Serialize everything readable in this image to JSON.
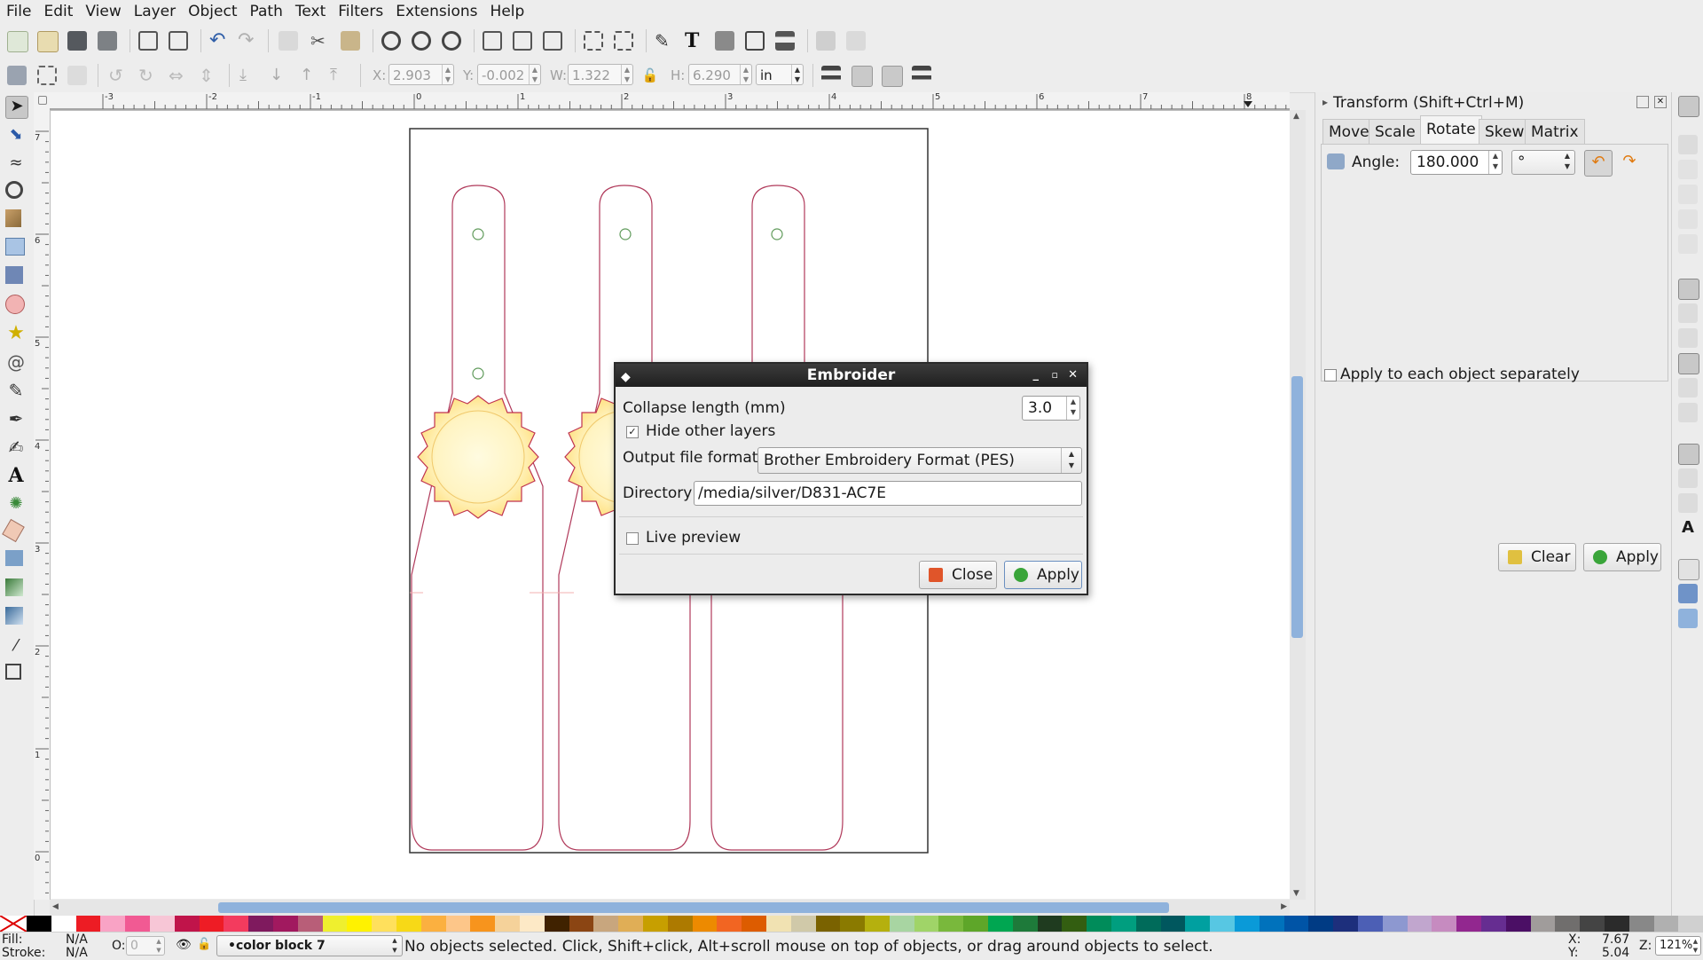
{
  "menu": [
    "File",
    "Edit",
    "View",
    "Layer",
    "Object",
    "Path",
    "Text",
    "Filters",
    "Extensions",
    "Help"
  ],
  "toolbar2": {
    "x_label": "X:",
    "x_value": "2.903",
    "y_label": "Y:",
    "y_value": "-0.002",
    "w_label": "W:",
    "w_value": "1.322",
    "h_label": "H:",
    "h_value": "6.290",
    "unit": "in"
  },
  "ruler_h": [
    "-3",
    "-2",
    "-1",
    "0",
    "1",
    "2",
    "3",
    "4",
    "5",
    "6",
    "7",
    "8"
  ],
  "ruler_v": [
    "7",
    "6",
    "5",
    "4",
    "3",
    "2",
    "1",
    "0"
  ],
  "embroider": {
    "title": "Embroider",
    "collapse_label": "Collapse length (mm)",
    "collapse_value": "3.0",
    "hide_layers_label": "Hide other layers",
    "hide_layers_checked": true,
    "output_format_label": "Output file format",
    "output_format_value": "Brother Embroidery Format (PES)",
    "directory_label": "Directory",
    "directory_value": "/media/silver/D831-AC7E",
    "live_preview_label": "Live preview",
    "live_preview_checked": false,
    "close_label": "Close",
    "apply_label": "Apply"
  },
  "transform": {
    "title": "Transform (Shift+Ctrl+M)",
    "tabs": [
      "Move",
      "Scale",
      "Rotate",
      "Skew",
      "Matrix"
    ],
    "active_tab": "Rotate",
    "angle_label": "Angle:",
    "angle_value": "180.000",
    "angle_unit": "°",
    "apply_each_label": "Apply to each object separately",
    "clear_label": "Clear",
    "apply_label": "Apply"
  },
  "palette": [
    "#000000",
    "#ffffff",
    "#ed1c24",
    "#f9a3c5",
    "#f15a93",
    "#f7c6d6",
    "#c0144a",
    "#ee1c25",
    "#f33b5e",
    "#7f1a5e",
    "#a1195f",
    "#b85e78",
    "#efef2e",
    "#fff200",
    "#ffe05c",
    "#f7d917",
    "#fbb040",
    "#fdc689",
    "#f7941d",
    "#f5d29a",
    "#fde9c6",
    "#402200",
    "#8b4513",
    "#c8a67e",
    "#e0ae56",
    "#c79f00",
    "#ad7a00",
    "#ed8a00",
    "#f26522",
    "#dd5c00",
    "#f1e2b2",
    "#d0c9a9",
    "#7a6200",
    "#8a7a00",
    "#b5b00e",
    "#a8d5a2",
    "#a0d468",
    "#79b83c",
    "#5ea629",
    "#00a651",
    "#1e7a3a",
    "#1f3b1f",
    "#335e11",
    "#008c5a",
    "#009e7f",
    "#006b5a",
    "#00575e",
    "#00a0a0",
    "#57c7e3",
    "#0a9ad8",
    "#0072bc",
    "#0054a6",
    "#003b84",
    "#1d2f7c",
    "#4c5fb5",
    "#8d98d0",
    "#c1a6ce",
    "#c68bc0",
    "#92278f",
    "#662d91",
    "#4b0f65",
    "#a09c9b",
    "#706e6d",
    "#444444",
    "#2b2b2b",
    "#888888",
    "#b0b0b0",
    "#d0d0d0"
  ],
  "status": {
    "fill_label": "Fill:",
    "fill_value": "N/A",
    "stroke_label": "Stroke:",
    "stroke_value": "N/A",
    "opacity_label": "O:",
    "opacity_value": "0",
    "layer": "•color block 7",
    "message": "No objects selected. Click, Shift+click, Alt+scroll mouse on top of objects, or drag around objects to select.",
    "x_label": "X:",
    "x_value": "7.67",
    "y_label": "Y:",
    "y_value": "5.04",
    "zoom_label": "Z:",
    "zoom_value": "121%"
  }
}
